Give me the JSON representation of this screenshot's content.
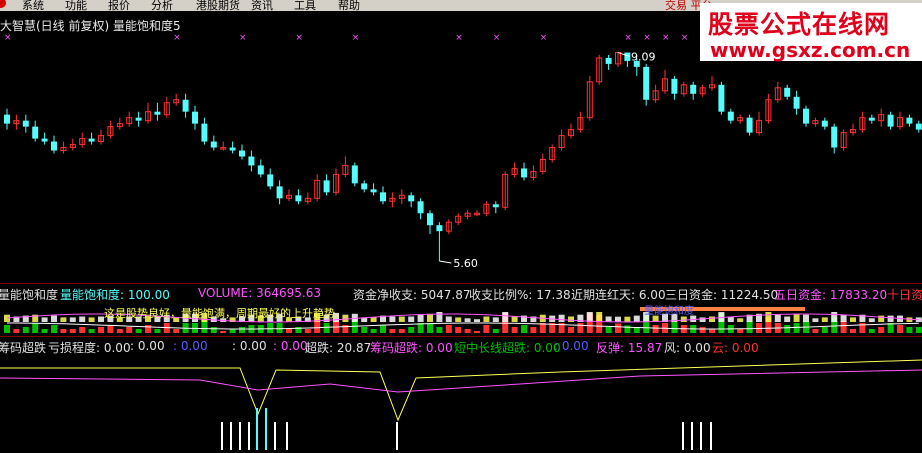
{
  "menu": {
    "items": [
      "系统",
      "功能",
      "报价",
      "分析",
      "港股期货",
      "资讯",
      "工具",
      "帮助"
    ],
    "right_text": "交易 平台"
  },
  "title": "大智慧(日线 前复权) 量能饱和度5",
  "watermark": {
    "title": "股票公式在线网",
    "url": "www.gsxz.com.cn"
  },
  "price_labels": {
    "high": "9.09",
    "low": "5.60"
  },
  "colors": {
    "up": "#ff3232",
    "down": "#54fcfc",
    "cyan": "#54fcfc",
    "magenta": "#ff54ff",
    "yellow": "#ffff54",
    "green": "#00c000",
    "white": "#e0e0e0"
  },
  "panel2": {
    "name": "量能饱和度",
    "indicator": "量能饱和度: 100.00",
    "volume": "VOLUME: 364695.63",
    "net": "资金净收支: 5047.87",
    "ratio": "收支比例%: 17.38",
    "recent": "近期连红天: 6.00",
    "three_day": "三日资金: 11224.50",
    "five_day": "五日资金: 17833.20",
    "ten_day": "十日资",
    "note": "这是股势良好，量能饱满，周期最好的上升趋势。",
    "tag": "量能饱和度"
  },
  "panel3": {
    "name": "筹码超跌",
    "loss": "亏损程度: 0.00",
    "v1": ": 0.00",
    "v2": ": 0.00",
    "v3": ": 0.00",
    "v4": ": 0.00",
    "super_fall": "超跌: 20.87",
    "chip_fall": "筹码超跌: 0.00",
    "trend": "短中长线超跌: 0.00",
    "t2": ": 0.00",
    "rebound": "反弹: 15.87",
    "wind": "风: 0.00",
    "cloud": "云: 0.00"
  },
  "chart_data": {
    "type": "candlestick",
    "candles": [
      [
        8.05,
        7.9,
        8.15,
        7.8
      ],
      [
        7.9,
        7.95,
        8.05,
        7.8
      ],
      [
        7.95,
        7.85,
        8.05,
        7.75
      ],
      [
        7.85,
        7.65,
        7.95,
        7.6
      ],
      [
        7.65,
        7.6,
        7.75,
        7.55
      ],
      [
        7.6,
        7.45,
        7.7,
        7.4
      ],
      [
        7.45,
        7.5,
        7.6,
        7.4
      ],
      [
        7.5,
        7.55,
        7.65,
        7.45
      ],
      [
        7.55,
        7.65,
        7.75,
        7.5
      ],
      [
        7.65,
        7.6,
        7.75,
        7.55
      ],
      [
        7.6,
        7.7,
        7.8,
        7.55
      ],
      [
        7.7,
        7.85,
        7.95,
        7.65
      ],
      [
        7.85,
        7.9,
        8.0,
        7.8
      ],
      [
        7.9,
        8.0,
        8.1,
        7.85
      ],
      [
        8.0,
        7.95,
        8.1,
        7.85
      ],
      [
        7.95,
        8.1,
        8.25,
        7.9
      ],
      [
        8.1,
        8.05,
        8.25,
        7.95
      ],
      [
        8.05,
        8.25,
        8.35,
        8.0
      ],
      [
        8.25,
        8.3,
        8.4,
        8.2
      ],
      [
        8.3,
        8.1,
        8.4,
        8.0
      ],
      [
        8.1,
        7.9,
        8.2,
        7.8
      ],
      [
        7.9,
        7.6,
        8.0,
        7.55
      ],
      [
        7.6,
        7.5,
        7.7,
        7.45
      ],
      [
        7.5,
        7.5,
        7.6,
        7.45
      ],
      [
        7.5,
        7.45,
        7.6,
        7.4
      ],
      [
        7.45,
        7.35,
        7.55,
        7.3
      ],
      [
        7.35,
        7.2,
        7.45,
        7.1
      ],
      [
        7.2,
        7.05,
        7.3,
        7.0
      ],
      [
        7.05,
        6.85,
        7.15,
        6.8
      ],
      [
        6.85,
        6.65,
        6.95,
        6.55
      ],
      [
        6.65,
        6.7,
        6.8,
        6.6
      ],
      [
        6.7,
        6.6,
        6.8,
        6.55
      ],
      [
        6.6,
        6.65,
        6.75,
        6.55
      ],
      [
        6.65,
        6.95,
        7.05,
        6.6
      ],
      [
        6.95,
        6.75,
        7.05,
        6.7
      ],
      [
        6.75,
        7.05,
        7.15,
        6.7
      ],
      [
        7.05,
        7.2,
        7.35,
        7.0
      ],
      [
        7.2,
        6.9,
        7.25,
        6.85
      ],
      [
        6.9,
        6.8,
        6.95,
        6.75
      ],
      [
        6.8,
        6.75,
        6.9,
        6.7
      ],
      [
        6.75,
        6.6,
        6.85,
        6.55
      ],
      [
        6.6,
        6.65,
        6.75,
        6.5
      ],
      [
        6.65,
        6.7,
        6.8,
        6.55
      ],
      [
        6.7,
        6.6,
        6.75,
        6.5
      ],
      [
        6.6,
        6.4,
        6.65,
        6.3
      ],
      [
        6.4,
        6.2,
        6.45,
        6.05
      ],
      [
        6.2,
        6.1,
        6.25,
        5.6
      ],
      [
        6.1,
        6.25,
        6.3,
        6.05
      ],
      [
        6.25,
        6.35,
        6.4,
        6.2
      ],
      [
        6.35,
        6.4,
        6.45,
        6.3
      ],
      [
        6.4,
        6.4,
        6.45,
        6.35
      ],
      [
        6.4,
        6.55,
        6.6,
        6.35
      ],
      [
        6.55,
        6.5,
        6.6,
        6.4
      ],
      [
        6.5,
        7.05,
        7.1,
        6.45
      ],
      [
        7.05,
        7.15,
        7.25,
        7.0
      ],
      [
        7.15,
        7.0,
        7.25,
        6.95
      ],
      [
        7.0,
        7.1,
        7.2,
        6.95
      ],
      [
        7.1,
        7.3,
        7.4,
        7.05
      ],
      [
        7.3,
        7.5,
        7.55,
        7.25
      ],
      [
        7.5,
        7.7,
        7.8,
        7.45
      ],
      [
        7.7,
        7.8,
        7.9,
        7.65
      ],
      [
        7.8,
        8.0,
        8.1,
        7.75
      ],
      [
        8.0,
        8.6,
        8.7,
        7.95
      ],
      [
        8.6,
        9.0,
        9.05,
        8.55
      ],
      [
        9.0,
        8.9,
        9.05,
        8.8
      ],
      [
        8.9,
        9.09,
        9.09,
        8.85
      ],
      [
        9.09,
        8.95,
        9.09,
        8.85
      ],
      [
        8.95,
        8.85,
        9.0,
        8.7
      ],
      [
        8.85,
        8.3,
        8.9,
        8.2
      ],
      [
        8.3,
        8.45,
        8.55,
        8.25
      ],
      [
        8.45,
        8.65,
        8.8,
        8.4
      ],
      [
        8.65,
        8.4,
        8.7,
        8.3
      ],
      [
        8.4,
        8.55,
        8.6,
        8.35
      ],
      [
        8.55,
        8.4,
        8.6,
        8.3
      ],
      [
        8.4,
        8.5,
        8.55,
        8.35
      ],
      [
        8.5,
        8.55,
        8.7,
        8.45
      ],
      [
        8.55,
        8.1,
        8.6,
        8.05
      ],
      [
        8.1,
        7.95,
        8.15,
        7.9
      ],
      [
        7.95,
        8.0,
        8.05,
        7.9
      ],
      [
        8.0,
        7.75,
        8.05,
        7.7
      ],
      [
        7.75,
        7.95,
        8.1,
        7.7
      ],
      [
        7.95,
        8.3,
        8.4,
        7.9
      ],
      [
        8.3,
        8.5,
        8.6,
        8.25
      ],
      [
        8.5,
        8.35,
        8.55,
        8.3
      ],
      [
        8.35,
        8.15,
        8.45,
        8.05
      ],
      [
        8.15,
        7.9,
        8.2,
        7.85
      ],
      [
        7.9,
        7.95,
        8.0,
        7.85
      ],
      [
        7.95,
        7.85,
        8.0,
        7.8
      ],
      [
        7.85,
        7.5,
        7.9,
        7.4
      ],
      [
        7.5,
        7.75,
        7.8,
        7.45
      ],
      [
        7.75,
        7.8,
        7.9,
        7.7
      ],
      [
        7.8,
        8.0,
        8.1,
        7.75
      ],
      [
        8.0,
        7.95,
        8.05,
        7.9
      ],
      [
        7.95,
        8.05,
        8.15,
        7.85
      ],
      [
        8.05,
        7.85,
        8.1,
        7.8
      ],
      [
        7.85,
        8.0,
        8.1,
        7.8
      ],
      [
        8.0,
        7.9,
        8.05,
        7.85
      ],
      [
        7.9,
        7.8,
        7.95,
        7.75
      ]
    ]
  }
}
